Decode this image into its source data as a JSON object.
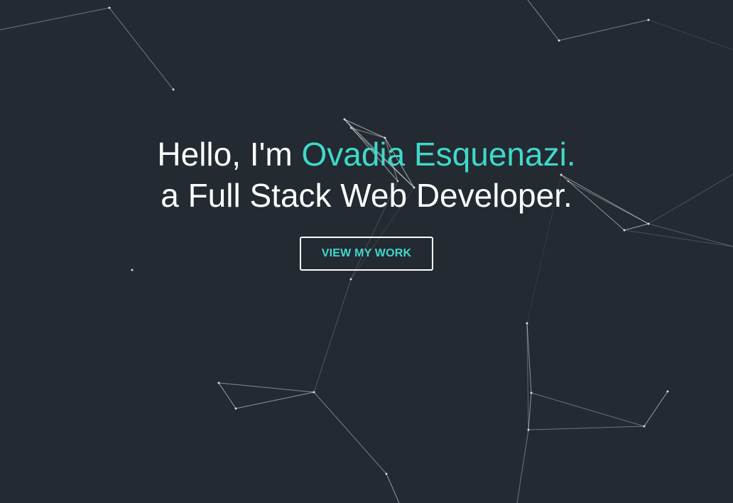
{
  "hero": {
    "greeting_prefix": "Hello, I'm ",
    "name": "Ovadia Esquenazi.",
    "tagline": "a Full Stack Web Developer.",
    "cta_label": "VIEW MY WORK"
  },
  "colors": {
    "background": "#232a32",
    "accent": "#3fd9c9",
    "text": "#ffffff",
    "particle_line": "#ffffff"
  }
}
